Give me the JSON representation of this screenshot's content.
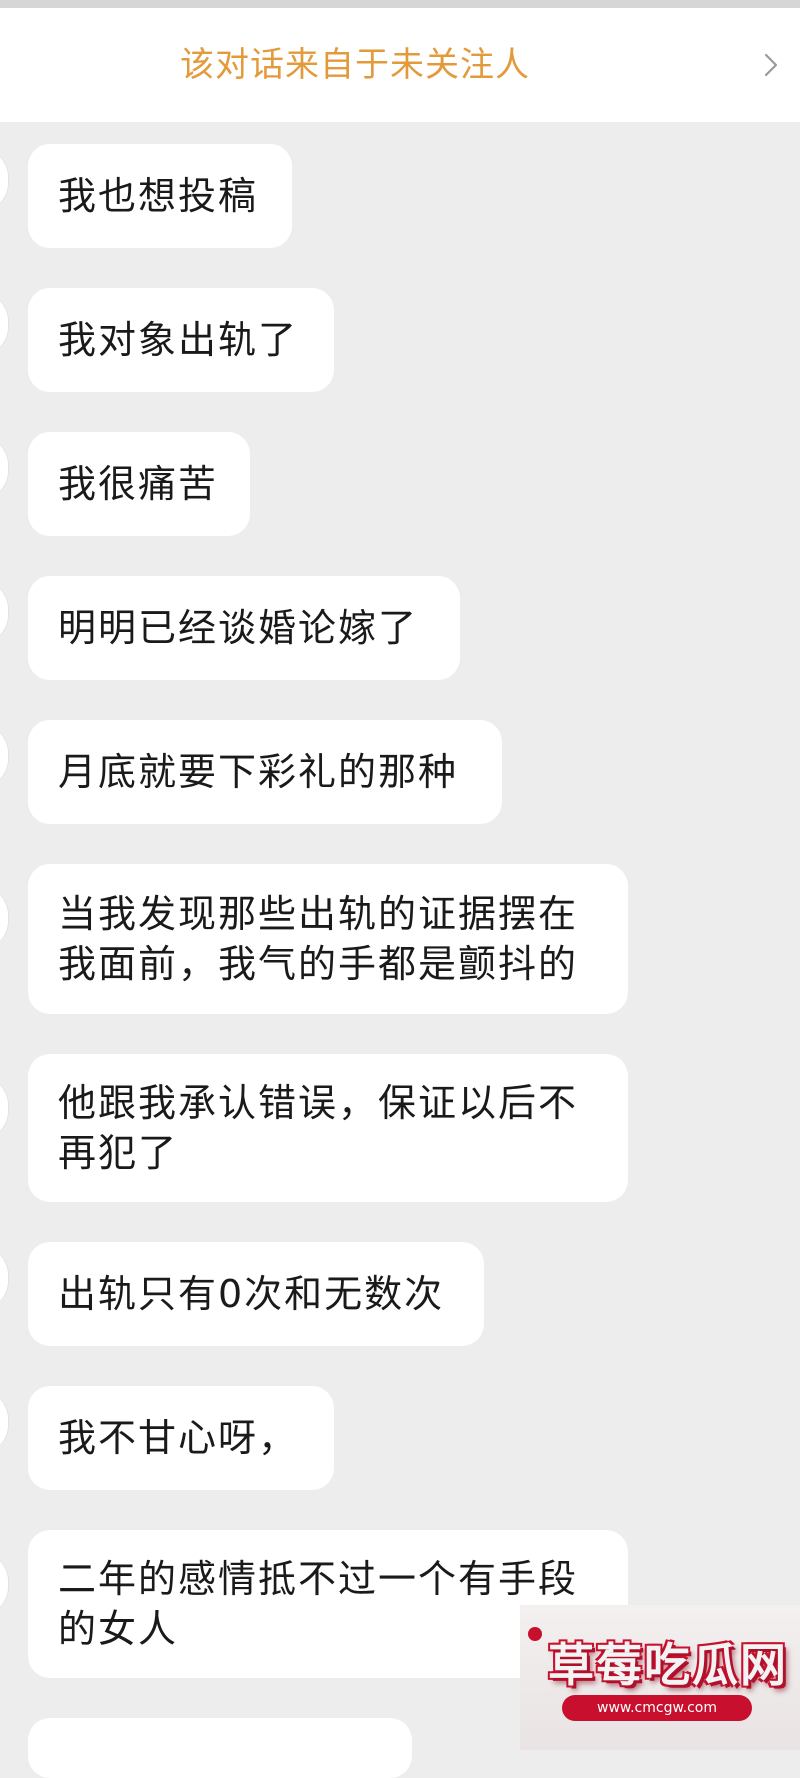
{
  "notice": {
    "text": "该对话来自于未关注人"
  },
  "messages": [
    "我也想投稿",
    "我对象出轨了",
    "我很痛苦",
    "明明已经谈婚论嫁了",
    "月底就要下彩礼的那种",
    "当我发现那些出轨的证据摆在\n我面前，我气的手都是颤抖的",
    "他跟我承认错误，保证以后不\n再犯了",
    "出轨只有0次和无数次",
    "我不甘心呀，",
    "二年的感情抵不过一个有手段\n的女人"
  ],
  "watermark": {
    "title": "草莓吃瓜网",
    "url": "www.cmcgw.com"
  },
  "colors": {
    "background": "#ededed",
    "bubble": "#ffffff",
    "notice_text": "#e39a3b",
    "watermark_red": "#c8102e"
  }
}
